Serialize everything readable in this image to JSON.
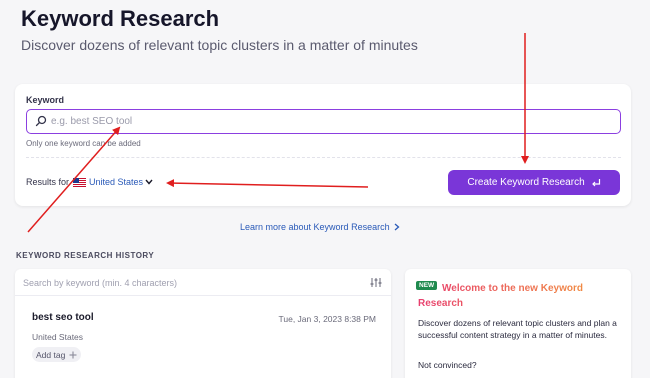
{
  "header": {
    "title": "Keyword Research",
    "subtitle": "Discover dozens of relevant topic clusters in a matter of minutes"
  },
  "search_card": {
    "keyword_label": "Keyword",
    "search_placeholder": "e.g. best SEO tool",
    "search_value": "",
    "hint": "Only one keyword can be added",
    "results_for_label": "Results for",
    "country": "United States",
    "create_button_label": "Create Keyword Research",
    "accent_color": "#7a36d8"
  },
  "learn_more": {
    "label": "Learn more about Keyword Research"
  },
  "history": {
    "section_label": "KEYWORD RESEARCH HISTORY",
    "search_placeholder": "Search by keyword (min. 4 characters)",
    "items": [
      {
        "keyword": "best seo tool",
        "date": "Tue, Jan 3, 2023 8:38 PM",
        "country": "United States",
        "add_tag_label": "Add tag"
      }
    ]
  },
  "promo": {
    "badge": "NEW",
    "title": "Welcome to the new Keyword Research",
    "body": "Discover dozens of relevant topic clusters and plan a successful content strategy in a matter of minutes.",
    "question": "Not convinced?"
  },
  "annotation_color": "#e01e1e"
}
